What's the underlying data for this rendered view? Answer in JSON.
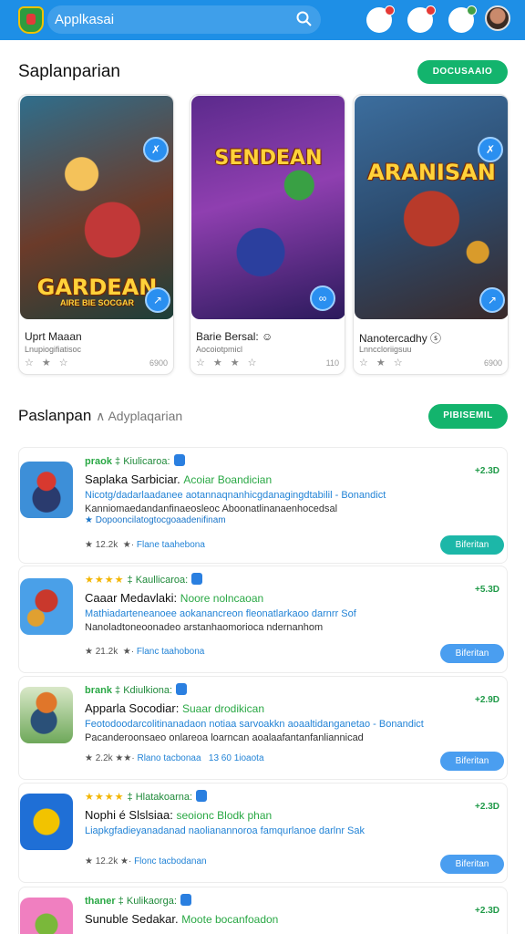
{
  "topbar": {
    "search_text": "Applkasai",
    "search_icon": "search-icon",
    "icons": [
      "notification-icon",
      "chat-icon",
      "friends-icon"
    ]
  },
  "featured": {
    "title": "Saplanparian",
    "button": "DOCUSAAIO",
    "cards": [
      {
        "art_title": "GARDEAN",
        "art_sub": "AIRE BIE SOCGAR",
        "name": "Uprt Maaan",
        "sub": "Lnupiogifiatisoc",
        "num": "6900"
      },
      {
        "art_title": "SENDEAN",
        "art_sub": "",
        "name": "Barie Bersal: ☺",
        "sub": "Aocoiotpmicl",
        "num": "110"
      },
      {
        "art_title": "ARANISAN",
        "art_sub": "",
        "name": "Nanotercadhy ⓢ",
        "sub": "Lnnccloriigsuu",
        "num": "6900"
      }
    ]
  },
  "list": {
    "title": "Paslanpan",
    "subtitle": "∧ Adyplaqarian",
    "button": "PIBISEMIL",
    "rows": [
      {
        "meta_left": "praok",
        "meta_right": "Kiulicaroa:",
        "stars": "",
        "title": "Saplaka Sarbiciar.",
        "tag": "Acoiar Boandician",
        "desc1": "Nicotg/dadarlaadanee aotannaqnanhicgdanagingdtabilil - Bonandict",
        "desc2": "Kanniomaedandanfinaeosleoc Aboonatlinanaenhocedsal",
        "desc3": "★ Dopooncilatogtocgoaadenifinam",
        "rating_left": "12.2k",
        "rating_link": "Flane taahebona",
        "count": "+2.3D",
        "button": "Biferitan"
      },
      {
        "meta_left": "",
        "meta_right": "Kaullicaroa:",
        "stars": "★★★★",
        "title": "Caaar Medavlaki:",
        "tag": "Noore nolncaoan",
        "desc1": "Mathiadarteneanoee aokanancreon fleonatlarkaoo darnrr Sof",
        "desc2": "Nanoladtoneoonadeo arstanhaomorioca ndernanhom",
        "desc3": "",
        "rating_left": "21.2k",
        "rating_link": "Flanc taahobona",
        "count": "+5.3D",
        "button": "Biferitan"
      },
      {
        "meta_left": "brank",
        "meta_right": "Kdiulkiona:",
        "stars": "",
        "title": "Apparla Socodiar:",
        "tag": "Suaar drodikican",
        "desc1": "Feotodoodarcolitinanadaon notiaa sarvoakkn aoaaltidanganetao - Bonandict",
        "desc2": "Pacanderoonsaeo onlareoa loarncan aoalaafantanfanliannicad",
        "desc3": "",
        "rating_left": "2.2k",
        "rating_link": "Rlano tacbonaa",
        "rating_extra": "13 60 1ioaota",
        "count": "+2.9D",
        "button": "Biferitan"
      },
      {
        "meta_left": "",
        "meta_right": "Hlatakoarna:",
        "stars": "★★★★",
        "title": "Nophi é Slslsiaa:",
        "tag": "seoionc Blodk phan",
        "desc1": "Liapkgfadieyanadanad naolianannoroa famqurlanoe darlnr Sak",
        "desc2": "",
        "desc3": "",
        "rating_left": "12.2k",
        "rating_link": "Flonc tacbodanan",
        "count": "+2.3D",
        "button": "Biferitan"
      },
      {
        "meta_left": "thaner",
        "meta_right": "Kulikaorga:",
        "stars": "",
        "title": "Sunuble Sedakar.",
        "tag": "Moote bocanfoadon",
        "desc1": "",
        "desc2": "",
        "desc3": "",
        "rating_left": "",
        "rating_link": "",
        "count": "+2.3D",
        "button": ""
      }
    ]
  },
  "colors": {
    "topbar": "#1e8fe6",
    "primary_green": "#13b46d",
    "link_blue": "#2283d6",
    "teal_button": "#1cb7a8",
    "blue_button": "#4a9ef0"
  }
}
